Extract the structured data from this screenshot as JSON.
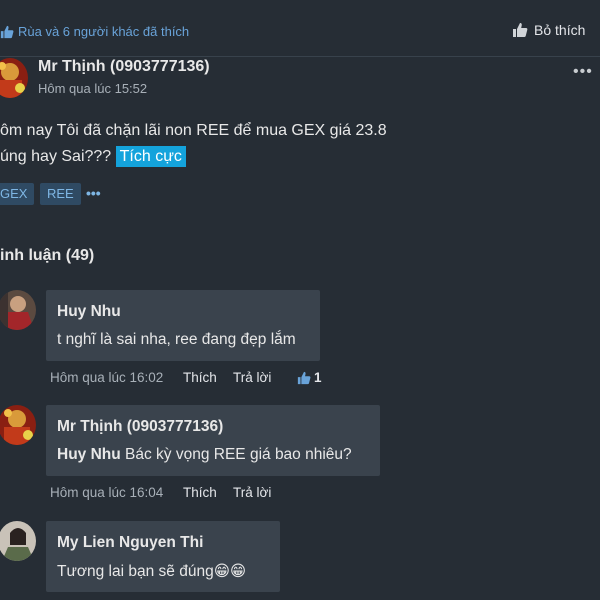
{
  "likes": {
    "text": "Rùa và 6 người khác đã thích",
    "unlike_label": "Bỏ thích",
    "icon": "thumbs-up-icon",
    "accent": "#69a3d9"
  },
  "post": {
    "author": "Mr Thịnh (0903777136)",
    "time": "Hôm qua lúc 15:52",
    "line1": "ôm nay Tôi đã chặn lãi non REE để mua GEX giá 23.8",
    "line2": "úng hay Sai???",
    "sentiment": "Tích cực",
    "sentiment_color": "#14a3dc",
    "tags": [
      "GEX",
      "REE"
    ],
    "more_tags": "•••",
    "more_icon": "•••"
  },
  "comments_title": "inh luận (49)",
  "comments": [
    {
      "name": "Huy Nhu",
      "text": "t nghĩ là sai nha, ree đang đẹp lắm",
      "time": "Hôm qua lúc 16:02",
      "like": "Thích",
      "reply": "Trả lời",
      "like_count": "1"
    },
    {
      "name": "Mr Thịnh (0903777136)",
      "mention": "Huy Nhu",
      "text": "Bác kỳ vọng REE giá bao nhiêu?",
      "time": "Hôm qua lúc 16:04",
      "like": "Thích",
      "reply": "Trả lời"
    },
    {
      "name": "My Lien Nguyen Thi",
      "text": "Tương lai bạn sẽ đúng😁😁"
    }
  ]
}
